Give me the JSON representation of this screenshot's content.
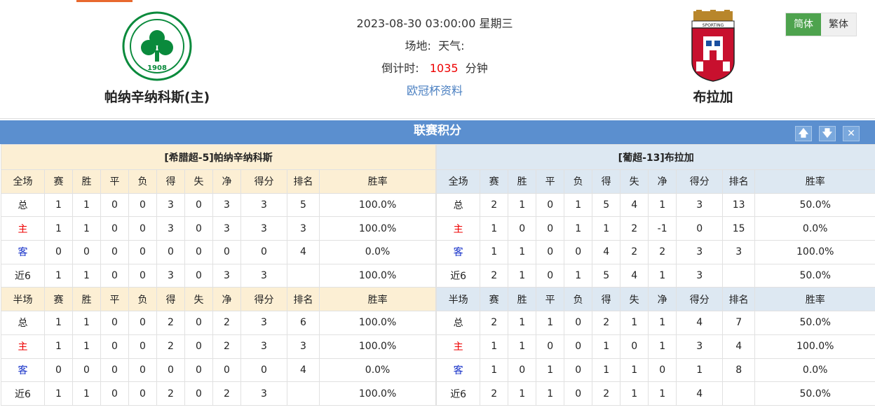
{
  "match": {
    "datetime": "2023-08-30 03:00:00 星期三",
    "venue_label": "场地:",
    "weather_label": "天气:",
    "countdown_label": "倒计时:",
    "countdown_value": "1035",
    "countdown_unit": "分钟",
    "league_link": "欧冠杯资料"
  },
  "home": {
    "name": "帕纳辛纳科斯(主)",
    "logo_year": "1908"
  },
  "away": {
    "name": "布拉加",
    "logo_text": "SPORTING"
  },
  "lang": {
    "simplified": "简体",
    "traditional": "繁体"
  },
  "section": {
    "title": "联赛积分"
  },
  "colors": {
    "accent_blue": "#5b8fcf",
    "active_green": "#4ea34e",
    "home_bg": "#fcefd4",
    "away_bg": "#dde8f2"
  },
  "home_table": {
    "caption": "[希腊超-5]帕纳辛纳科斯",
    "full_header": [
      "全场",
      "赛",
      "胜",
      "平",
      "负",
      "得",
      "失",
      "净",
      "得分",
      "排名",
      "胜率"
    ],
    "full_rows": [
      [
        "总",
        "1",
        "1",
        "0",
        "0",
        "3",
        "0",
        "3",
        "3",
        "5",
        "100.0%"
      ],
      [
        "主",
        "1",
        "1",
        "0",
        "0",
        "3",
        "0",
        "3",
        "3",
        "3",
        "100.0%"
      ],
      [
        "客",
        "0",
        "0",
        "0",
        "0",
        "0",
        "0",
        "0",
        "0",
        "4",
        "0.0%"
      ],
      [
        "近6",
        "1",
        "1",
        "0",
        "0",
        "3",
        "0",
        "3",
        "3",
        "",
        "100.0%"
      ]
    ],
    "half_header": [
      "半场",
      "赛",
      "胜",
      "平",
      "负",
      "得",
      "失",
      "净",
      "得分",
      "排名",
      "胜率"
    ],
    "half_rows": [
      [
        "总",
        "1",
        "1",
        "0",
        "0",
        "2",
        "0",
        "2",
        "3",
        "6",
        "100.0%"
      ],
      [
        "主",
        "1",
        "1",
        "0",
        "0",
        "2",
        "0",
        "2",
        "3",
        "3",
        "100.0%"
      ],
      [
        "客",
        "0",
        "0",
        "0",
        "0",
        "0",
        "0",
        "0",
        "0",
        "4",
        "0.0%"
      ],
      [
        "近6",
        "1",
        "1",
        "0",
        "0",
        "2",
        "0",
        "2",
        "3",
        "",
        "100.0%"
      ]
    ]
  },
  "away_table": {
    "caption": "[葡超-13]布拉加",
    "full_header": [
      "全场",
      "赛",
      "胜",
      "平",
      "负",
      "得",
      "失",
      "净",
      "得分",
      "排名",
      "胜率"
    ],
    "full_rows": [
      [
        "总",
        "2",
        "1",
        "0",
        "1",
        "5",
        "4",
        "1",
        "3",
        "13",
        "50.0%"
      ],
      [
        "主",
        "1",
        "0",
        "0",
        "1",
        "1",
        "2",
        "-1",
        "0",
        "15",
        "0.0%"
      ],
      [
        "客",
        "1",
        "1",
        "0",
        "0",
        "4",
        "2",
        "2",
        "3",
        "3",
        "100.0%"
      ],
      [
        "近6",
        "2",
        "1",
        "0",
        "1",
        "5",
        "4",
        "1",
        "3",
        "",
        "50.0%"
      ]
    ],
    "half_header": [
      "半场",
      "赛",
      "胜",
      "平",
      "负",
      "得",
      "失",
      "净",
      "得分",
      "排名",
      "胜率"
    ],
    "half_rows": [
      [
        "总",
        "2",
        "1",
        "1",
        "0",
        "2",
        "1",
        "1",
        "4",
        "7",
        "50.0%"
      ],
      [
        "主",
        "1",
        "1",
        "0",
        "0",
        "1",
        "0",
        "1",
        "3",
        "4",
        "100.0%"
      ],
      [
        "客",
        "1",
        "0",
        "1",
        "0",
        "1",
        "1",
        "0",
        "1",
        "8",
        "0.0%"
      ],
      [
        "近6",
        "2",
        "1",
        "1",
        "0",
        "2",
        "1",
        "1",
        "4",
        "",
        "50.0%"
      ]
    ]
  }
}
